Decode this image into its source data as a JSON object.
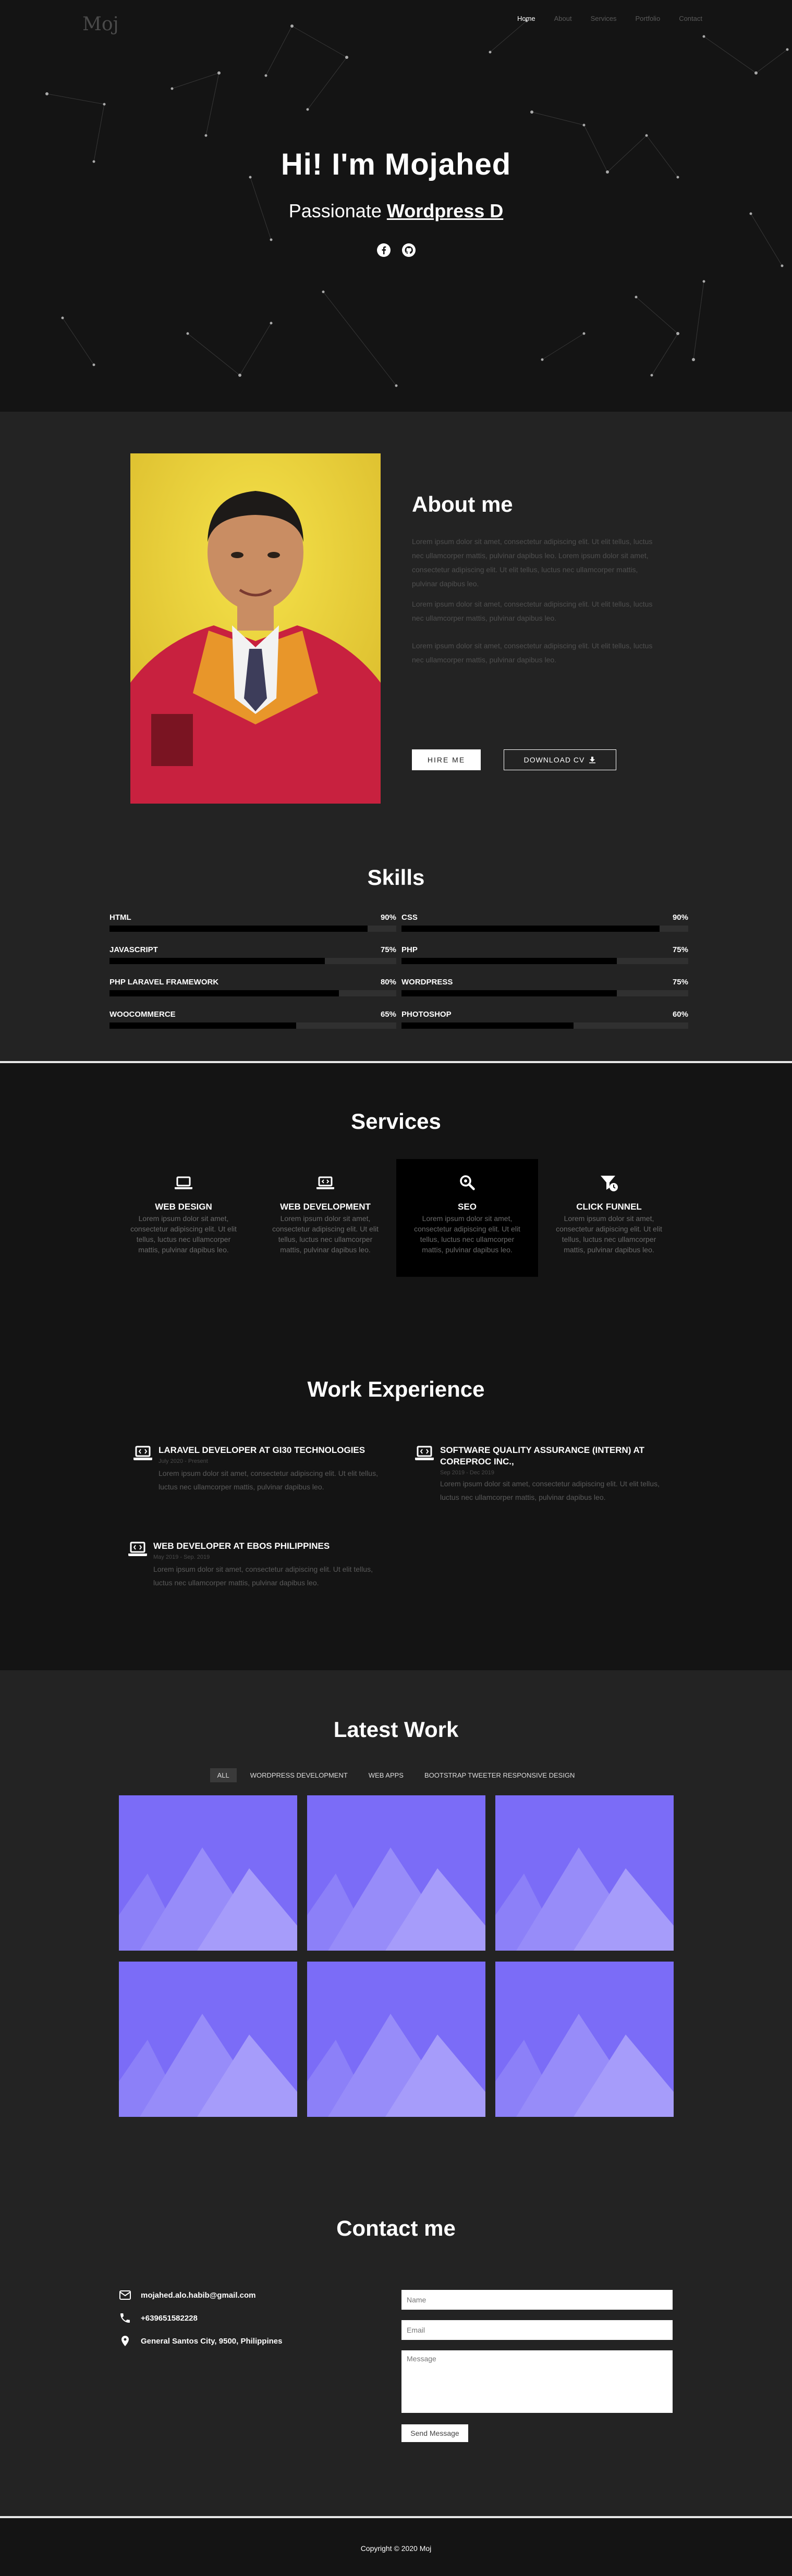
{
  "nav": {
    "logo": "Moj",
    "items": [
      "Home",
      "About",
      "Services",
      "Portfolio",
      "Contact"
    ]
  },
  "hero": {
    "title": "Hi! I'm Mojahed",
    "subtitle_prefix": "Passionate",
    "subtitle_typed": "Wordpress D"
  },
  "about": {
    "title": "About me",
    "paragraphs": [
      "Lorem ipsum dolor sit amet, consectetur adipiscing elit. Ut elit tellus, luctus nec ullamcorper mattis, pulvinar dapibus leo. Lorem ipsum dolor sit amet, consectetur adipiscing elit. Ut elit tellus, luctus nec ullamcorper mattis, pulvinar dapibus leo.",
      "Lorem ipsum dolor sit amet, consectetur adipiscing elit. Ut elit tellus, luctus nec ullamcorper mattis, pulvinar dapibus leo.",
      "Lorem ipsum dolor sit amet, consectetur adipiscing elit. Ut elit tellus, luctus nec ullamcorper mattis, pulvinar dapibus leo."
    ],
    "hire_label": "HIRE ME",
    "cv_label": "DOWNLOAD CV"
  },
  "skills": {
    "title": "Skills",
    "items": [
      {
        "name": "HTML",
        "percent": 90,
        "label": "90%"
      },
      {
        "name": "CSS",
        "percent": 90,
        "label": "90%"
      },
      {
        "name": "JAVASCRIPT",
        "percent": 75,
        "label": "75%"
      },
      {
        "name": "PHP",
        "percent": 75,
        "label": "75%"
      },
      {
        "name": "PHP LARAVEL FRAMEWORK",
        "percent": 80,
        "label": "80%"
      },
      {
        "name": "WORDPRESS",
        "percent": 75,
        "label": "75%"
      },
      {
        "name": "WOOCOMMERCE",
        "percent": 65,
        "label": "65%"
      },
      {
        "name": "PHOTOSHOP",
        "percent": 60,
        "label": "60%"
      }
    ]
  },
  "services": {
    "title": "Services",
    "items": [
      {
        "title": "WEB DESIGN",
        "icon": "laptop-icon",
        "desc": "Lorem ipsum dolor sit amet, consectetur adipiscing elit. Ut elit tellus, luctus nec ullamcorper mattis, pulvinar dapibus leo."
      },
      {
        "title": "WEB DEVELOPMENT",
        "icon": "laptop-code-icon",
        "desc": "Lorem ipsum dolor sit amet, consectetur adipiscing elit. Ut elit tellus, luctus nec ullamcorper mattis, pulvinar dapibus leo."
      },
      {
        "title": "SEO",
        "icon": "search-icon",
        "desc": "Lorem ipsum dolor sit amet, consectetur adipiscing elit. Ut elit tellus, luctus nec ullamcorper mattis, pulvinar dapibus leo."
      },
      {
        "title": "CLICK FUNNEL",
        "icon": "funnel-icon",
        "desc": "Lorem ipsum dolor sit amet, consectetur adipiscing elit. Ut elit tellus, luctus nec ullamcorper mattis, pulvinar dapibus leo."
      }
    ]
  },
  "experience": {
    "title": "Work Experience",
    "items": [
      {
        "title": "LARAVEL DEVELOPER AT GI30 TECHNOLOGIES",
        "date": "July 2020 - Present",
        "desc": "Lorem ipsum dolor sit amet, consectetur adipiscing elit. Ut elit tellus, luctus nec ullamcorper mattis, pulvinar dapibus leo."
      },
      {
        "title": "SOFTWARE QUALITY ASSURANCE (INTERN) AT COREPROC INC.,",
        "date": "Sep 2019 - Dec 2019",
        "desc": "Lorem ipsum dolor sit amet, consectetur adipiscing elit. Ut elit tellus, luctus nec ullamcorper mattis, pulvinar dapibus leo."
      },
      {
        "title": "WEB DEVELOPER AT EBOS PHILIPPINES",
        "date": "May 2019 - Sep. 2019",
        "desc": "Lorem ipsum dolor sit amet, consectetur adipiscing elit. Ut elit tellus, luctus nec ullamcorper mattis, pulvinar dapibus leo."
      }
    ]
  },
  "work": {
    "title": "Latest Work",
    "filters": [
      "ALL",
      "WORDPRESS DEVELOPMENT",
      "WEB APPS",
      "BOOTSTRAP TWEETER RESPONSIVE DESIGN"
    ]
  },
  "contact": {
    "title": "Contact me",
    "email": "mojahed.alo.habib@gmail.com",
    "phone": "+639651582228",
    "address": "General Santos City, 9500, Philippines",
    "name_placeholder": "Name",
    "email_placeholder": "Email",
    "message_placeholder": "Message",
    "send_label": "Send Message"
  },
  "footer": {
    "copyright": "Copyright © 2020 Moj"
  },
  "colors": {
    "hero_bg": "#141414",
    "section_bg": "#232323",
    "tile_bg": "#7b6cf7"
  }
}
